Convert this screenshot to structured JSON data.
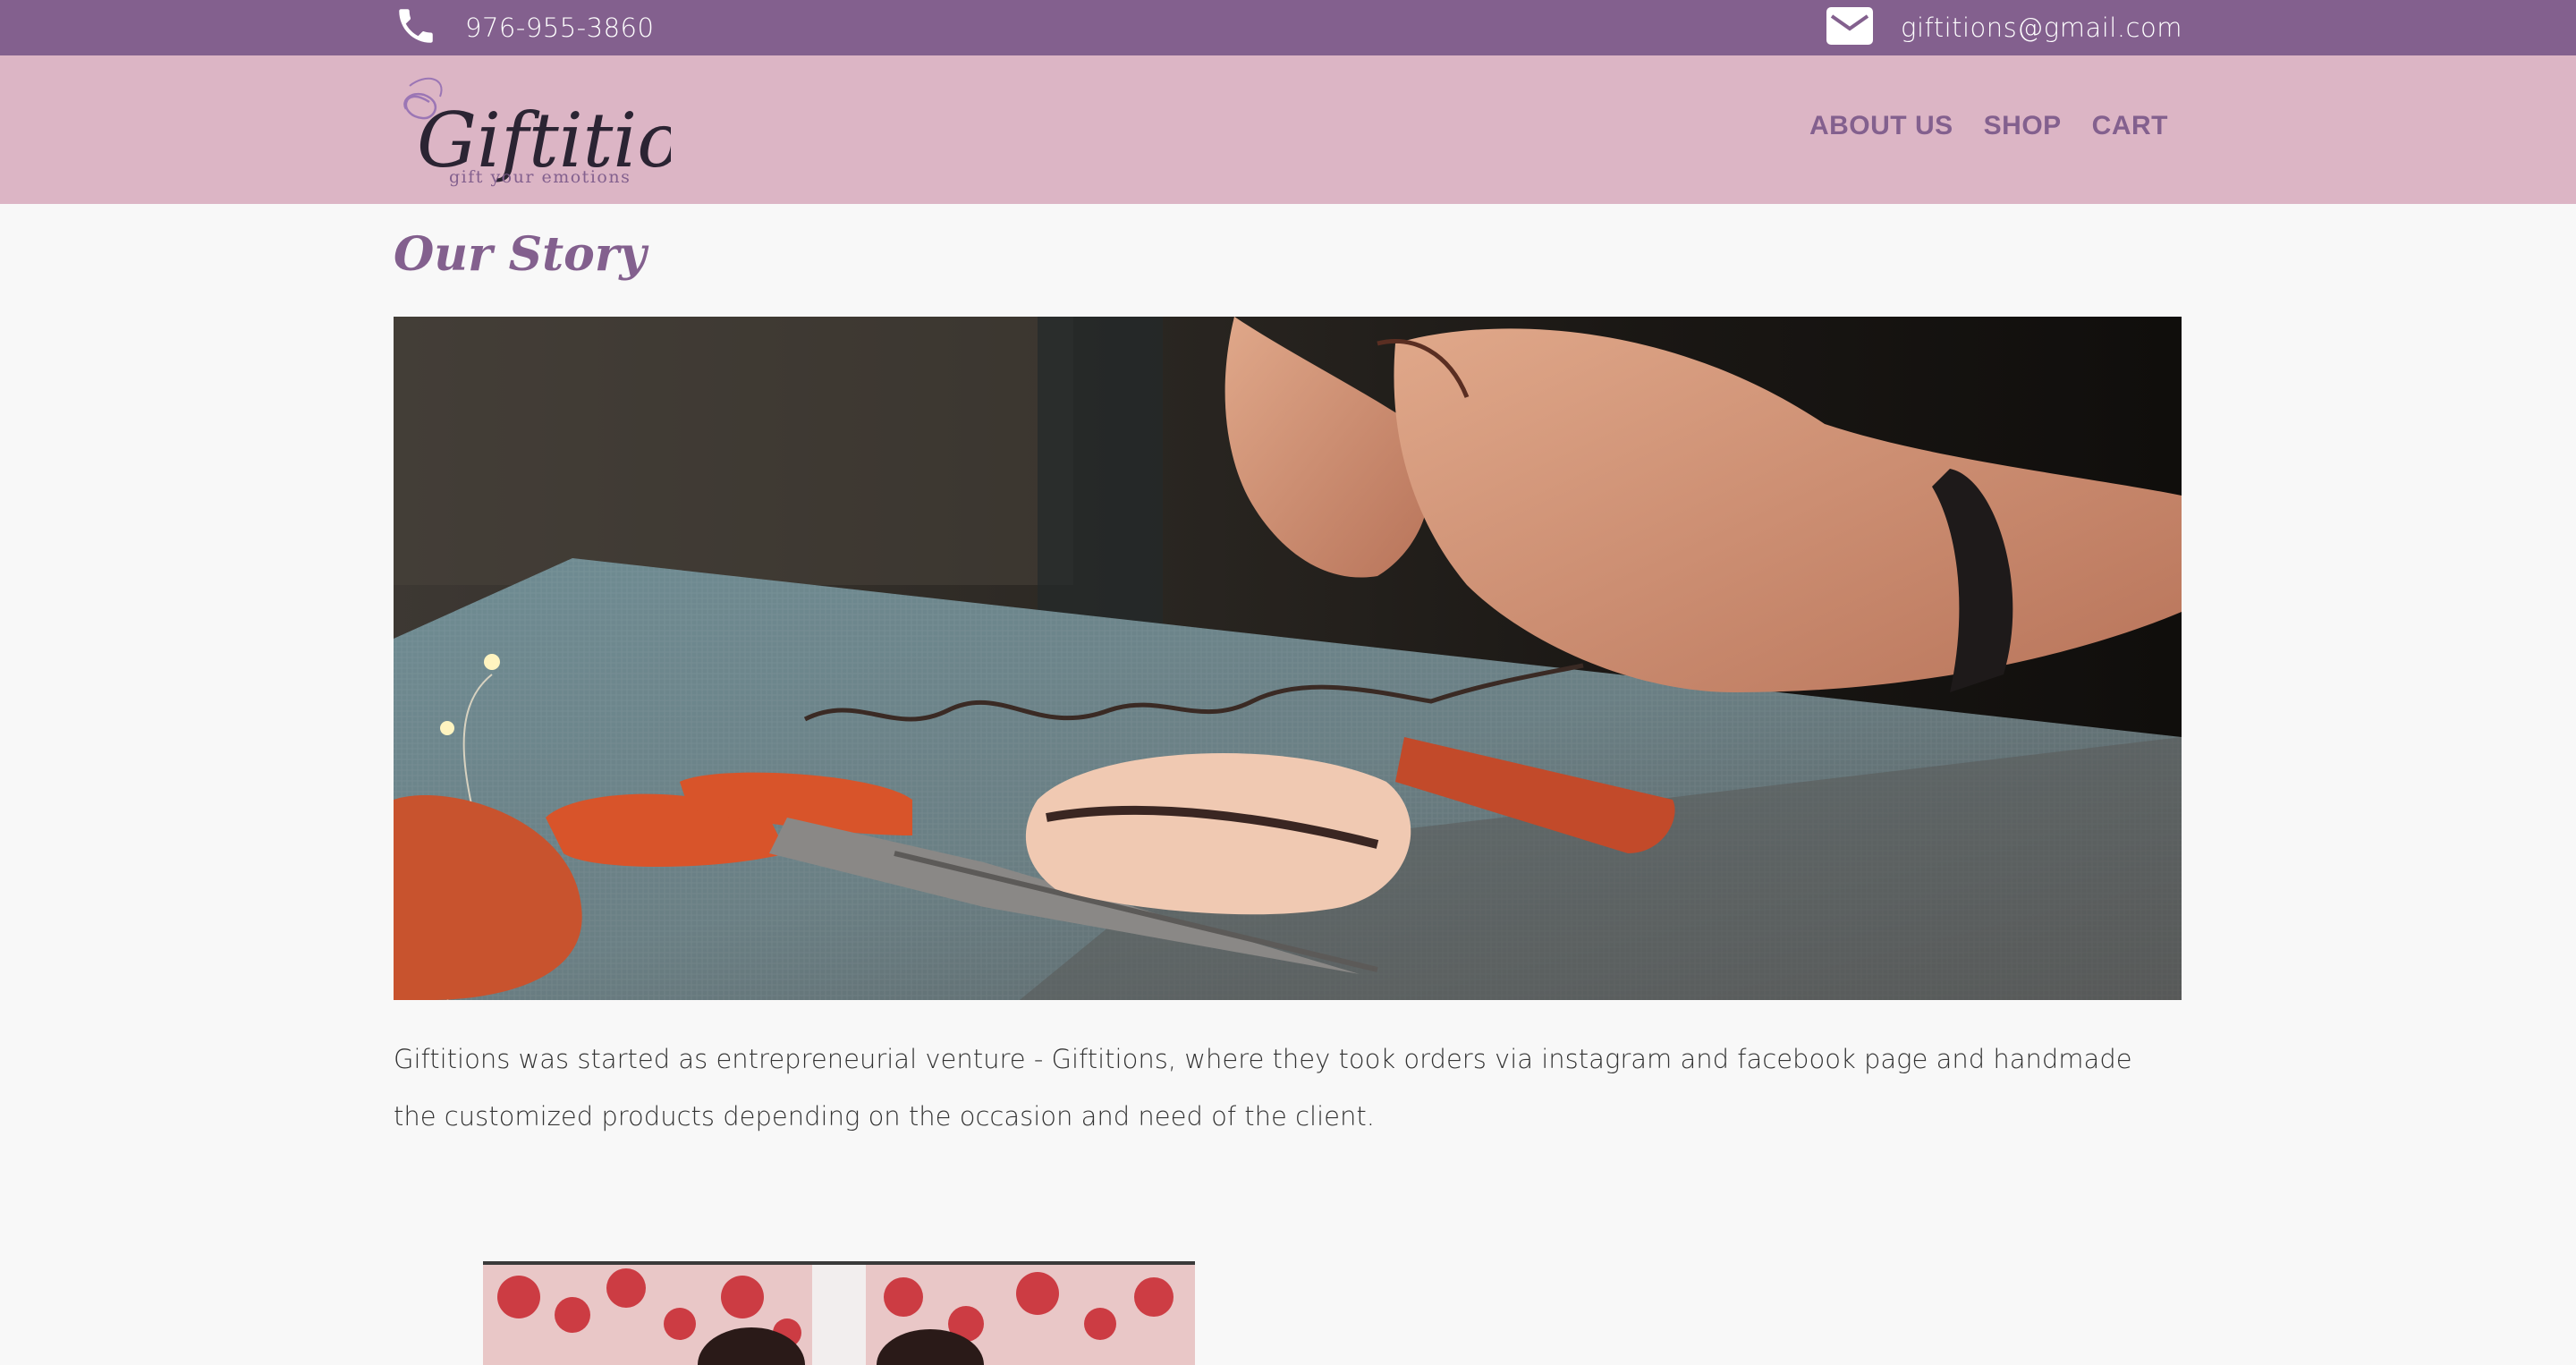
{
  "contact": {
    "phone": "976-955-3860",
    "email": "giftitions@gmail.com",
    "phone_icon": "phone-icon",
    "mail_icon": "envelope-icon"
  },
  "brand": {
    "name": "Giftitions",
    "tagline": "gift your emotions"
  },
  "nav": {
    "items": [
      "ABOUT US",
      "SHOP",
      "CART"
    ]
  },
  "page": {
    "title": "Our Story",
    "story_text": "Giftitions was started as entrepreneurial venture - Giftitions, where they took orders via instagram and facebook page and handmade the customized products depending on the occasion and need of the client."
  },
  "colors": {
    "topbar": "#83608e",
    "navbar": "#dcb5c5",
    "accent": "#83608e",
    "background": "#f8f8f8"
  }
}
